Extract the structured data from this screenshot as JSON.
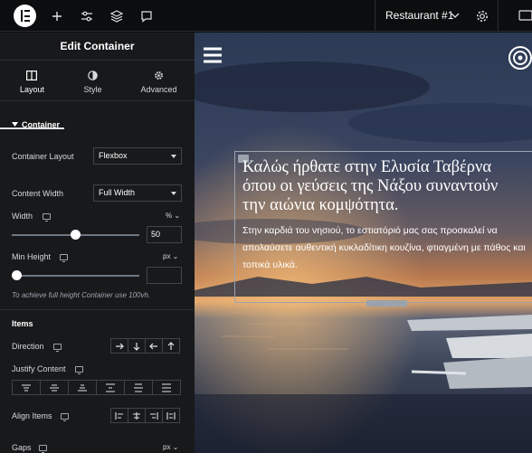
{
  "topbar": {
    "site_name": "Restaurant #1"
  },
  "panel": {
    "title": "Edit Container",
    "tabs": [
      {
        "label": "Layout",
        "icon": "layout-icon",
        "active": true
      },
      {
        "label": "Style",
        "icon": "style-icon",
        "active": false
      },
      {
        "label": "Advanced",
        "icon": "gear-icon",
        "active": false
      }
    ],
    "container_section": "Container",
    "container_layout_label": "Container Layout",
    "container_layout_value": "Flexbox",
    "content_width_label": "Content Width",
    "content_width_value": "Full Width",
    "width_label": "Width",
    "width_unit": "%",
    "width_value": "50",
    "width_slider_fraction": 0.5,
    "min_height_label": "Min Height",
    "min_height_unit": "px",
    "min_height_value": "",
    "min_height_slider_fraction": 0,
    "hint": "To achieve full height Container use 100vh.",
    "items_section": "Items",
    "direction_label": "Direction",
    "justify_label": "Justify Content",
    "align_label": "Align Items",
    "gaps_label": "Gaps",
    "gaps_unit": "px"
  },
  "canvas": {
    "hero_title": "Καλώς ήρθατε στην Ελυσία Ταβέρνα\nόπου οι γεύσεις της Νάξου συναντούν\nτην αιώνια κομψότητα.",
    "hero_body": "Στην καρδιά του νησιού, το εστιατόριό μας σας προσκαλεί να\nαπολαύσετε αυθεντική κυκλαδίτικη κουζίνα, φτιαγμένη με πάθος και\nτοπικά υλικά."
  },
  "colors": {
    "panel_bg": "#18191b",
    "topbar_bg": "#0c0d0e",
    "accent_text": "#ffffff"
  }
}
